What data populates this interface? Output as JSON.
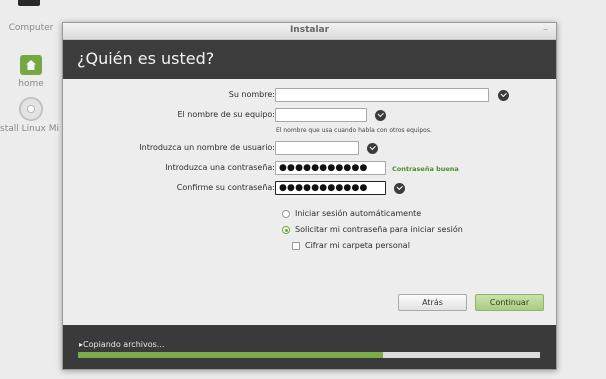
{
  "desktop": {
    "icons": [
      {
        "label": "Computer",
        "icon": "computer-icon"
      },
      {
        "label": "home",
        "icon": "home-folder-icon"
      },
      {
        "label": "stall Linux Mi",
        "icon": "disc-icon"
      }
    ]
  },
  "window": {
    "title": "Instalar",
    "minimize_glyph": "–",
    "heading": "¿Quién es usted?"
  },
  "form": {
    "name": {
      "label": "Su nombre:",
      "value": ""
    },
    "computer": {
      "label": "El nombre de su equipo:",
      "value": "",
      "hint": "El nombre que usa cuando habla con otros equipos."
    },
    "username": {
      "label": "Introduzca un nombre de usuario:",
      "value": ""
    },
    "password": {
      "label": "Introduzca una contraseña:",
      "masked": "●●●●●●●●●●●",
      "strength": "Contraseña buena"
    },
    "confirm": {
      "label": "Confirme su contraseña:",
      "masked": "●●●●●●●●●●●"
    },
    "options": {
      "auto_login": {
        "label": "Iniciar sesión automáticamente",
        "selected": false
      },
      "require_password": {
        "label": "Solicitar mi contraseña para iniciar sesión",
        "selected": true
      },
      "encrypt_home": {
        "label": "Cifrar mi carpeta personal",
        "checked": false
      }
    }
  },
  "buttons": {
    "back": "Atrás",
    "continue": "Continuar"
  },
  "progress": {
    "text": "▸Copiando archivos...",
    "fraction": 0.66
  },
  "colors": {
    "accent_green": "#7aad49",
    "header_dark": "#3c3c3c",
    "strength_green": "#4c8d2a"
  }
}
